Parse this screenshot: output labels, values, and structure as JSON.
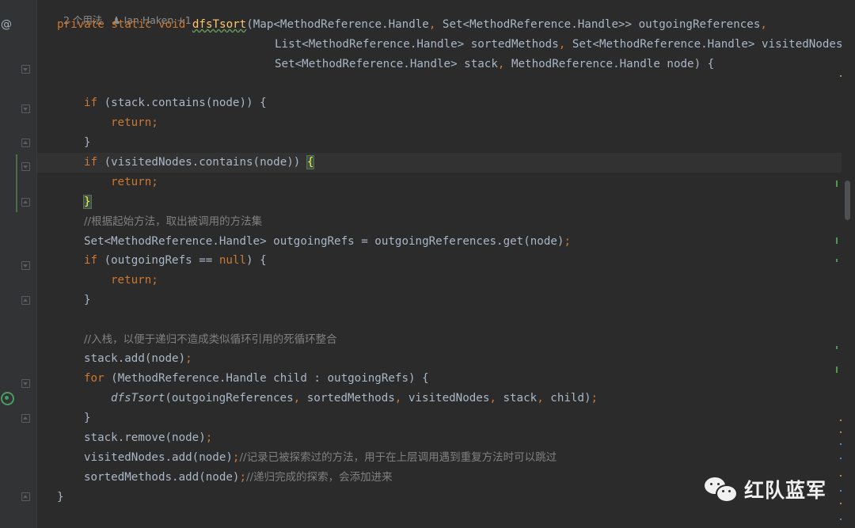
{
  "hint": {
    "usages": "2 个用法",
    "author": "Ian Haken +1"
  },
  "gutter": {
    "override_icon": "@",
    "recursion_icon": "recursive-call-icon"
  },
  "code": {
    "sig1": [
      "private",
      " ",
      "static",
      " ",
      "void",
      " ",
      "dfsTsort",
      "(Map<MethodReference.Handle",
      ", ",
      "Set<MethodReference.Handle>> outgoingReferences",
      ","
    ],
    "sig2": [
      "List<MethodReference.Handle> sortedMethods",
      ", ",
      "Set<MethodReference.Handle> visitedNodes",
      ","
    ],
    "sig3": [
      "Set<MethodReference.Handle> stack",
      ", ",
      "MethodReference.Handle node) {"
    ],
    "l5": [
      "if",
      " (stack.contains(node)) {"
    ],
    "l6": [
      "return",
      ";"
    ],
    "l7": "}",
    "l8": [
      "if",
      " (visitedNodes.contains(node)) ",
      "{"
    ],
    "l9": [
      "return",
      ";"
    ],
    "l10": "}",
    "l11": "//根据起始方法，取出被调用的方法集",
    "l12": [
      "Set<MethodReference.Handle> outgoingRefs = outgoingReferences.get(node)",
      ";"
    ],
    "l13": [
      "if",
      " (outgoingRefs == ",
      "null",
      ") {"
    ],
    "l14": [
      "return",
      ";"
    ],
    "l15": "}",
    "l17": "//入栈，以便于递归不造成类似循环引用的死循环整合",
    "l18": [
      "stack.add(node)",
      ";"
    ],
    "l19": [
      "for",
      " (MethodReference.Handle child : outgoingRefs) {"
    ],
    "l20": [
      "dfsTsort",
      "(outgoingReferences",
      ", ",
      "sortedMethods",
      ", ",
      "visitedNodes",
      ", ",
      "stack",
      ", ",
      "child)",
      ";"
    ],
    "l21": "}",
    "l22": [
      "stack.remove(node)",
      ";"
    ],
    "l23": [
      "visitedNodes.add(node)",
      ";",
      "//记录已被探索过的方法，用于在上层调用遇到重复方法时可以跳过"
    ],
    "l24": [
      "sortedMethods.add(node)",
      ";",
      "//递归完成的探索，会添加进来"
    ],
    "l25": "}"
  },
  "watermark": {
    "name": "红队蓝军",
    "icon": "wechat-icon"
  },
  "colors": {
    "background": "#2b2b2b",
    "keyword": "#cc7832",
    "method": "#ffc66d",
    "comment": "#808080",
    "text": "#a9b7c6"
  }
}
